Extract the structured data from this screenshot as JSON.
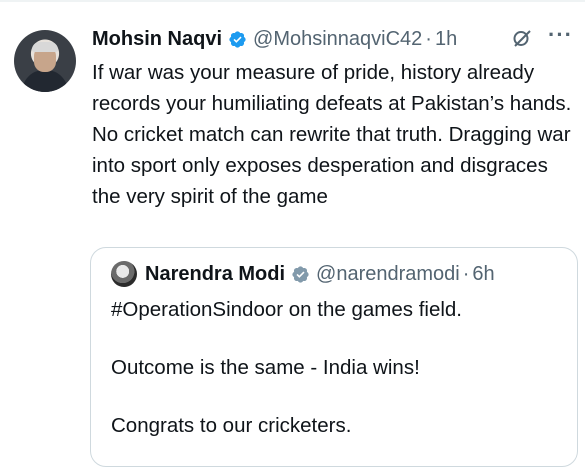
{
  "post": {
    "author_name": "Mohsin Naqvi",
    "handle": "@MohsinnaqviC42",
    "separator": "·",
    "time": "1h",
    "more_label": "···",
    "text": "If war was your measure of pride, history already records your humiliating defeats at Pakistan’s hands. No cricket match can rewrite that truth. Dragging war into sport only exposes desperation and disgraces the very spirit of the game"
  },
  "quoted": {
    "author_name": "Narendra Modi",
    "handle": "@narendramodi",
    "separator": "·",
    "time": "6h",
    "lines": [
      "#OperationSindoor on the games field.",
      "Outcome is the same - India wins!",
      "Congrats to our cricketers."
    ]
  },
  "colors": {
    "verified_blue": "#1d9bf0",
    "verified_gray": "#829aab",
    "secondary_text": "#536471",
    "border": "#cfd9de"
  },
  "icons": [
    "verified-badge-icon",
    "grok-icon",
    "more-icon",
    "gray-verified-badge-icon"
  ]
}
